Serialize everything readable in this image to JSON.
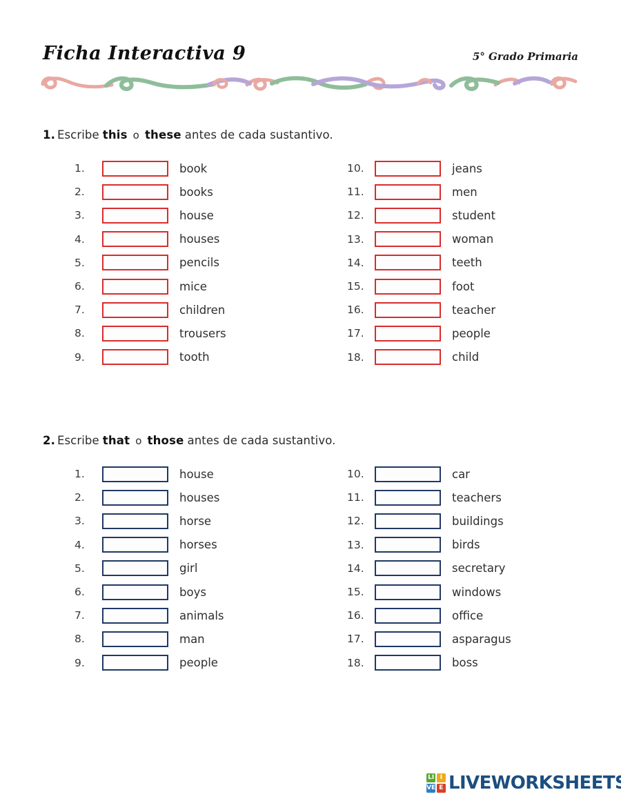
{
  "header": {
    "title": "Ficha Interactiva 9",
    "grade": "5° Grado Primaria",
    "divider_colors": {
      "pink": "#e8a9a2",
      "green": "#8fbd9a",
      "purple": "#b6a6d8"
    }
  },
  "exercises": [
    {
      "number": "1.",
      "instruction_verb": "Escribe",
      "keyword_1": "this",
      "conjunction": "o",
      "keyword_2": "these",
      "instruction_tail": "antes de cada sustantivo.",
      "box_color": "#d92b2b",
      "left_column": [
        {
          "num": "1.",
          "word": "book"
        },
        {
          "num": "2.",
          "word": "books"
        },
        {
          "num": "3.",
          "word": "house"
        },
        {
          "num": "4.",
          "word": "houses"
        },
        {
          "num": "5.",
          "word": "pencils"
        },
        {
          "num": "6.",
          "word": "mice"
        },
        {
          "num": "7.",
          "word": "children"
        },
        {
          "num": "8.",
          "word": "trousers"
        },
        {
          "num": "9.",
          "word": "tooth"
        }
      ],
      "right_column": [
        {
          "num": "10.",
          "word": "jeans"
        },
        {
          "num": "11.",
          "word": "men"
        },
        {
          "num": "12.",
          "word": "student"
        },
        {
          "num": "13.",
          "word": "woman"
        },
        {
          "num": "14.",
          "word": "teeth"
        },
        {
          "num": "15.",
          "word": "foot"
        },
        {
          "num": "16.",
          "word": "teacher"
        },
        {
          "num": "17.",
          "word": "people"
        },
        {
          "num": "18.",
          "word": "child"
        }
      ]
    },
    {
      "number": "2.",
      "instruction_verb": "Escribe",
      "keyword_1": "that",
      "conjunction": "o",
      "keyword_2": "those",
      "instruction_tail": "antes de cada sustantivo.",
      "box_color": "#1f3864",
      "left_column": [
        {
          "num": "1.",
          "word": "house"
        },
        {
          "num": "2.",
          "word": "houses"
        },
        {
          "num": "3.",
          "word": "horse"
        },
        {
          "num": "4.",
          "word": "horses"
        },
        {
          "num": "5.",
          "word": "girl"
        },
        {
          "num": "6.",
          "word": "boys"
        },
        {
          "num": "7.",
          "word": "animals"
        },
        {
          "num": "8.",
          "word": "man"
        },
        {
          "num": "9.",
          "word": "people"
        }
      ],
      "right_column": [
        {
          "num": "10.",
          "word": "car"
        },
        {
          "num": "11.",
          "word": "teachers"
        },
        {
          "num": "12.",
          "word": "buildings"
        },
        {
          "num": "13.",
          "word": "birds"
        },
        {
          "num": "14.",
          "word": "secretary"
        },
        {
          "num": "15.",
          "word": "windows"
        },
        {
          "num": "16.",
          "word": "office"
        },
        {
          "num": "17.",
          "word": "asparagus"
        },
        {
          "num": "18.",
          "word": "boss"
        }
      ]
    }
  ],
  "footer": {
    "logo_tiles": [
      "LI",
      "I",
      "VE",
      "E"
    ],
    "logo_tile_letters": {
      "l": "LI",
      "i": "I",
      "v": "VE",
      "e": "E"
    },
    "logo_text": "LIVEWORKSHEETS",
    "logo_color": "#1c4e80"
  }
}
